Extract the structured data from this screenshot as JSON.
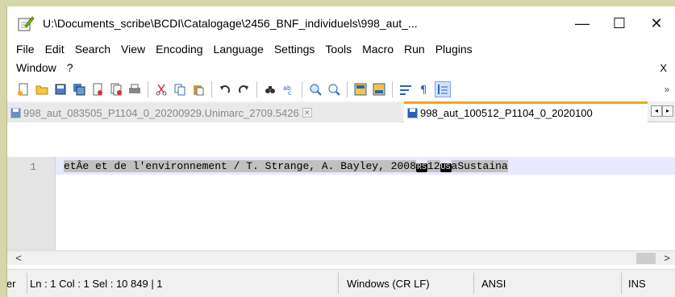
{
  "window": {
    "title": "U:\\Documents_scribe\\BCDI\\Catalogage\\2456_BNF_individuels\\998_aut_...",
    "controls": {
      "minimize": "—",
      "maximize": "☐",
      "close": "✕"
    }
  },
  "menu": {
    "row1": [
      "File",
      "Edit",
      "Search",
      "View",
      "Encoding",
      "Language",
      "Settings",
      "Tools",
      "Macro",
      "Run",
      "Plugins"
    ],
    "row2": [
      "Window",
      "?"
    ],
    "close_doc": "X"
  },
  "toolbar": {
    "icons": [
      "new-file-icon",
      "open-file-icon",
      "save-icon",
      "save-all-icon",
      "close-icon",
      "close-all-icon",
      "print-icon",
      "cut-icon",
      "copy-icon",
      "paste-icon",
      "undo-icon",
      "redo-icon",
      "find-icon",
      "replace-icon",
      "zoom-in-icon",
      "zoom-out-icon",
      "sync-vertical-icon",
      "sync-horizontal-icon",
      "word-wrap-icon",
      "show-all-chars-icon",
      "indent-guide-icon"
    ],
    "overflow": "»"
  },
  "tabs": [
    {
      "label": "998_aut_083505_P1104_0_20200929.Unimarc_2709.5426",
      "active": false,
      "close": "✕"
    },
    {
      "label": "998_aut_100512_P1104_0_2020100",
      "active": true
    }
  ],
  "tabnav": {
    "left": "◂",
    "right": "▸"
  },
  "editor": {
    "line_number": "1",
    "text_before": "etÂe et de l'environnement / T. Strange, A. Bayley, 2008",
    "ctrl1": "RS",
    "text_mid": "12",
    "ctrl2": "US",
    "text_after": "aSustaina"
  },
  "hscroll": {
    "left": "<",
    "right": ">"
  },
  "status": {
    "lang": "ler",
    "position": "Ln : 1    Col : 1    Sel : 10 849 | 1",
    "eol": "Windows (CR LF)",
    "encoding": "ANSI",
    "mode": "INS"
  },
  "colors": {
    "background": "#d6d7a8",
    "tab_accent": "#f7a31c",
    "current_line": "#e8e8ff"
  }
}
